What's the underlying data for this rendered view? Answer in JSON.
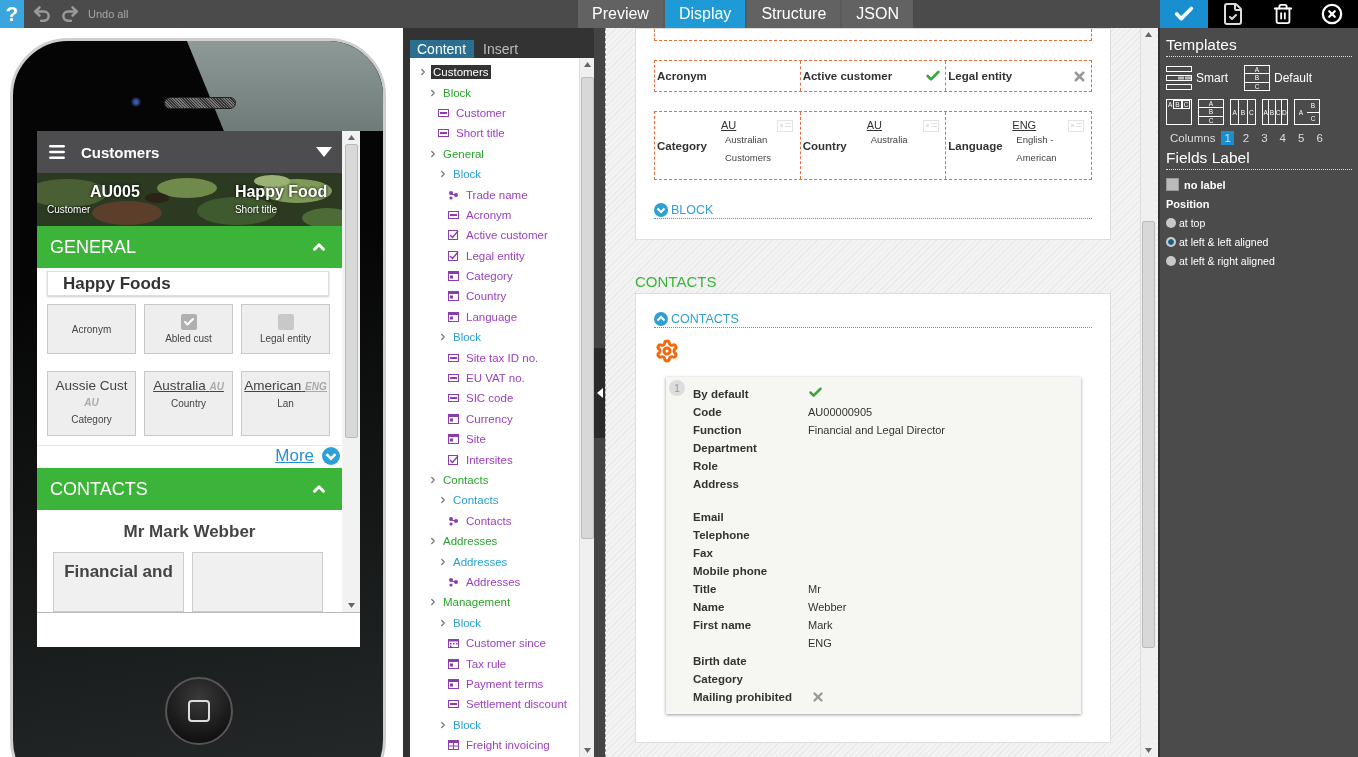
{
  "toolbar": {
    "help": "?",
    "undo_all": "Undo all"
  },
  "view_tabs": [
    {
      "label": "Preview",
      "selected": false
    },
    {
      "label": "Display",
      "selected": true
    },
    {
      "label": "Structure",
      "selected": false
    },
    {
      "label": "JSON",
      "selected": false
    }
  ],
  "actions": [
    {
      "kind": "save"
    },
    {
      "kind": "validate"
    },
    {
      "kind": "delete"
    },
    {
      "kind": "close"
    }
  ],
  "phone": {
    "header": "Customers",
    "banner": [
      {
        "value": "AU005",
        "label": "Customer"
      },
      {
        "value": "Happy Food",
        "label": "Short title"
      }
    ],
    "general": {
      "title": "GENERAL",
      "expanded": true,
      "trade_name": "Happy Foods",
      "tiles": [
        {
          "kind": "text",
          "label": "Acronym"
        },
        {
          "kind": "check",
          "label": "Abled cust",
          "checked": true
        },
        {
          "kind": "check",
          "label": "Legal entity",
          "checked": false
        },
        {
          "kind": "ref",
          "value": "Aussie Cust",
          "code": "AU",
          "label": "Category",
          "linked": false
        },
        {
          "kind": "ref",
          "value": "Australia",
          "code": "AU",
          "label": "Country",
          "linked": true
        },
        {
          "kind": "ref",
          "value": "American",
          "code": "ENG",
          "label": "Lan",
          "linked": true
        }
      ],
      "more": "More"
    },
    "contacts": {
      "title": "CONTACTS",
      "expanded": true,
      "name": "Mr Mark Webber",
      "cards": [
        "Financial and"
      ]
    }
  },
  "tree_tabs": [
    {
      "label": "Content",
      "selected": true
    },
    {
      "label": "Insert",
      "selected": false
    }
  ],
  "tree": {
    "label": "Customers",
    "selected": true,
    "children": [
      {
        "label": "Block",
        "selected": false,
        "children": [
          {
            "label": "Customer",
            "kind": "text",
            "selected": false
          },
          {
            "label": "Short title",
            "kind": "text",
            "selected": false
          }
        ]
      },
      {
        "label": "General",
        "selected": false,
        "children": [
          {
            "label": "Block",
            "selected": false,
            "children": [
              {
                "label": "Trade name",
                "kind": "collection",
                "selected": false
              },
              {
                "label": "Acronym",
                "kind": "text",
                "selected": false
              },
              {
                "label": "Active customer",
                "kind": "check",
                "selected": false
              },
              {
                "label": "Legal entity",
                "kind": "check",
                "selected": false
              },
              {
                "label": "Category",
                "kind": "select",
                "selected": false
              },
              {
                "label": "Country",
                "kind": "select",
                "selected": false
              },
              {
                "label": "Language",
                "kind": "select",
                "selected": false
              }
            ]
          },
          {
            "label": "Block",
            "selected": false,
            "children": [
              {
                "label": "Site tax ID no.",
                "kind": "text",
                "selected": false
              },
              {
                "label": "EU VAT no.",
                "kind": "text",
                "selected": false
              },
              {
                "label": "SIC code",
                "kind": "text",
                "selected": false
              },
              {
                "label": "Currency",
                "kind": "select",
                "selected": false
              },
              {
                "label": "Site",
                "kind": "select",
                "selected": false
              },
              {
                "label": "Intersites",
                "kind": "check",
                "selected": false
              }
            ]
          }
        ]
      },
      {
        "label": "Contacts",
        "selected": false,
        "children": [
          {
            "label": "Contacts",
            "selected": false,
            "children": [
              {
                "label": "Contacts",
                "kind": "collection",
                "selected": false
              }
            ]
          }
        ]
      },
      {
        "label": "Addresses",
        "selected": false,
        "children": [
          {
            "label": "Addresses",
            "selected": false,
            "children": [
              {
                "label": "Addresses",
                "kind": "collection",
                "selected": false
              }
            ]
          }
        ]
      },
      {
        "label": "Management",
        "selected": false,
        "children": [
          {
            "label": "Block",
            "selected": false,
            "children": [
              {
                "label": "Customer since",
                "kind": "date",
                "selected": false
              },
              {
                "label": "Tax rule",
                "kind": "select",
                "selected": false
              },
              {
                "label": "Payment terms",
                "kind": "select",
                "selected": false
              },
              {
                "label": "Settlement discount",
                "kind": "text",
                "selected": false
              }
            ]
          },
          {
            "label": "Block",
            "selected": false,
            "children": [
              {
                "label": "Freight invoicing",
                "kind": "table",
                "selected": false
              }
            ]
          }
        ]
      }
    ]
  },
  "canvas": {
    "rows": [
      [
        {
          "kind": "text",
          "label": "Acronym"
        },
        {
          "kind": "check",
          "label": "Active customer",
          "checked": true
        },
        {
          "kind": "check",
          "label": "Legal entity",
          "checked": false
        }
      ],
      [
        {
          "kind": "ref",
          "label": "Category",
          "code": "AU",
          "value": "Australian Customers"
        },
        {
          "kind": "ref",
          "label": "Country",
          "code": "AU",
          "value": "Australia"
        },
        {
          "kind": "ref",
          "label": "Language",
          "code": "ENG",
          "value": "English - American"
        }
      ]
    ],
    "block": {
      "title": "BLOCK",
      "expanded": false
    },
    "section": "CONTACTS",
    "contacts_block": {
      "title": "CONTACTS",
      "expanded": true
    },
    "contact": {
      "index": "1",
      "fields": [
        {
          "kind": "check",
          "label": "By default",
          "checked": true
        },
        {
          "kind": "text",
          "label": "Code",
          "value": "AU00000905"
        },
        {
          "kind": "text",
          "label": "Function",
          "value": "Financial and Legal Director"
        },
        {
          "kind": "text",
          "label": "Department"
        },
        {
          "kind": "text",
          "label": "Role"
        },
        {
          "kind": "multiline",
          "label": "Address"
        },
        {
          "kind": "text",
          "label": "Email"
        },
        {
          "kind": "text",
          "label": "Telephone"
        },
        {
          "kind": "text",
          "label": "Fax"
        },
        {
          "kind": "text",
          "label": "Mobile phone"
        },
        {
          "kind": "text",
          "label": "Title",
          "value": "Mr"
        },
        {
          "kind": "text",
          "label": "Name",
          "value": "Webber"
        },
        {
          "kind": "text",
          "label": "First name",
          "value": "Mark"
        },
        {
          "kind": "text",
          "value": "ENG"
        },
        {
          "kind": "text",
          "label": "Birth date"
        },
        {
          "kind": "text",
          "label": "Category"
        },
        {
          "kind": "check",
          "label": "Mailing prohibited",
          "checked": false
        }
      ]
    }
  },
  "properties": {
    "templates_title": "Templates",
    "templates": [
      {
        "kind": "smart",
        "label": "Smart"
      },
      {
        "kind": "stacked",
        "label": "Default",
        "cells": [
          "A",
          "B",
          "C"
        ]
      }
    ],
    "layouts": [
      {
        "kind": "inline",
        "cells": [
          "A",
          "B",
          "C"
        ]
      },
      {
        "kind": "stacked",
        "cells": [
          "A",
          "B",
          "C"
        ]
      },
      {
        "kind": "columns",
        "cells": [
          "A",
          "B",
          "C"
        ]
      },
      {
        "kind": "columns",
        "cells": [
          "A",
          "B",
          "C",
          "D"
        ]
      },
      {
        "kind": "split",
        "cells": [
          "A",
          "B",
          "C"
        ]
      }
    ],
    "columns_label": "Columns",
    "columns": [
      {
        "label": "1",
        "selected": true
      },
      {
        "label": "2",
        "selected": false
      },
      {
        "label": "3",
        "selected": false
      },
      {
        "label": "4",
        "selected": false
      },
      {
        "label": "5",
        "selected": false
      },
      {
        "label": "6",
        "selected": false
      }
    ],
    "fields_label_title": "Fields Label",
    "no_label": {
      "label": "no label",
      "checked": false
    },
    "position_title": "Position",
    "positions": [
      {
        "label": "at top",
        "selected": false
      },
      {
        "label": "at left & left aligned",
        "selected": true
      },
      {
        "label": "at left & right aligned",
        "selected": false
      }
    ]
  }
}
